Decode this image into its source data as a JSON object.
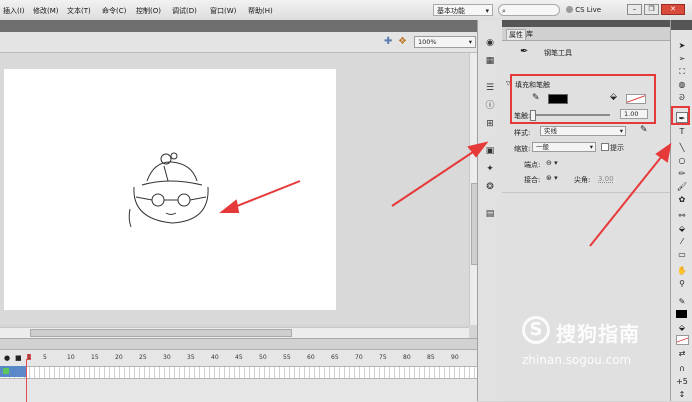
{
  "menu": [
    "插入(I)",
    "修改(M)",
    "文本(T)",
    "命令(C)",
    "控制(O)",
    "调试(D)",
    "窗口(W)",
    "帮助(H)"
  ],
  "workspace": {
    "label": "基本功能",
    "cslive": "CS Live"
  },
  "zoom": "100%",
  "timeline": {
    "frame_numbers": [
      "1",
      "5",
      "10",
      "15",
      "20",
      "25",
      "30",
      "35",
      "40",
      "45",
      "50",
      "55",
      "60",
      "65",
      "70",
      "75",
      "80",
      "85",
      "90"
    ]
  },
  "properties": {
    "tabs": [
      "属性",
      "库"
    ],
    "tool_name": "钢笔工具",
    "section": "填充和笔触",
    "stroke_label": "笔触:",
    "stroke_value": "1.00",
    "style_label": "样式:",
    "style_value": "实线",
    "scale_label": "缩放:",
    "scale_value": "一般",
    "hint_label": "提示",
    "cap_label": "端点:",
    "join_label": "接合:",
    "miter_label": "尖角:",
    "miter_value": "3.00"
  },
  "watermark": {
    "brand": "搜狗指南",
    "url": "zhinan.sogou.com"
  },
  "colors": {
    "annotation": "#e63a3a",
    "stroke_color": "#000000"
  }
}
